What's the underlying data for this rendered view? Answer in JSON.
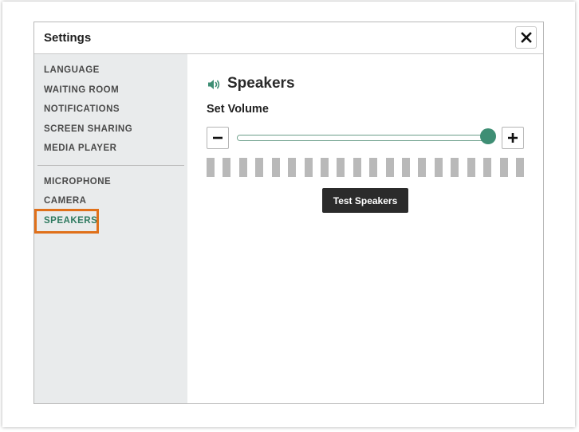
{
  "dialog": {
    "title": "Settings",
    "close_label": "close"
  },
  "sidebar": {
    "groups": [
      [
        "LANGUAGE",
        "WAITING ROOM",
        "NOTIFICATIONS",
        "SCREEN SHARING",
        "MEDIA PLAYER"
      ],
      [
        "MICROPHONE",
        "CAMERA",
        "SPEAKERS"
      ]
    ],
    "active_item": "SPEAKERS"
  },
  "speakers": {
    "section_icon": "speaker-icon",
    "title": "Speakers",
    "set_volume_label": "Set Volume",
    "volume_fraction": 1.0,
    "meter_bar_count": 20,
    "test_button_label": "Test Speakers"
  },
  "colors": {
    "accent": "#3e8e74",
    "active_nav": "#2f7a60",
    "highlight_outline": "#e0701a",
    "sidebar_bg": "#e9ebec",
    "meter_bar": "#b9b9b9",
    "button_dark": "#2b2b2b"
  }
}
